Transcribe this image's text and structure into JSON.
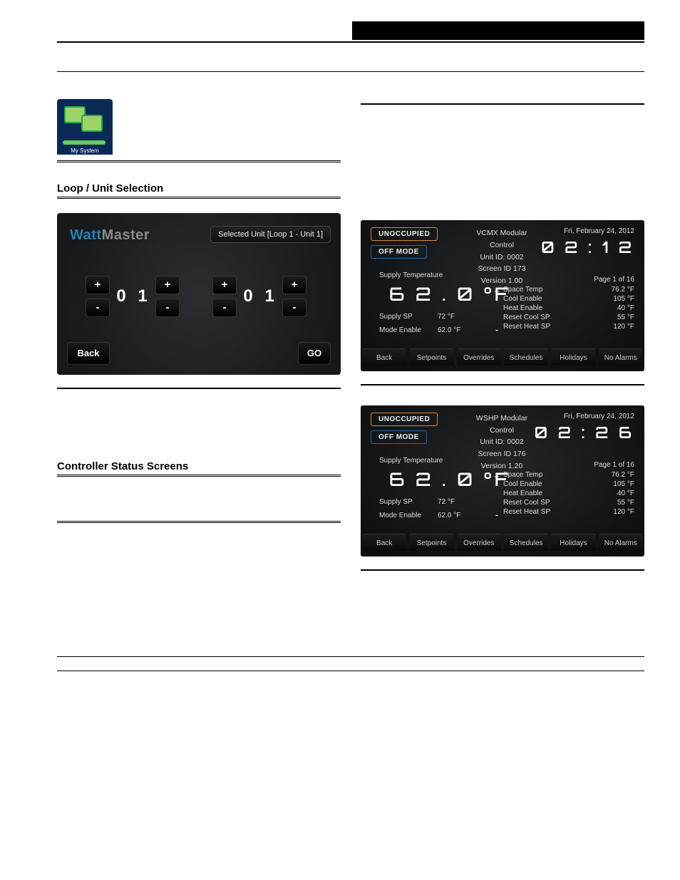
{
  "header": {
    "black_bar_label": ""
  },
  "left": {
    "mysystem_icon_label": "My System",
    "subhead1": "Loop / Unit Selection",
    "subhead2": "Controller Status Screens",
    "wm": {
      "logo_watt": "Watt",
      "logo_master": "Master",
      "chip": "Selected Unit [Loop 1 - Unit 1]",
      "stepper_plus": "+",
      "stepper_minus": "-",
      "digit_left_a": "0",
      "digit_left_b": "1",
      "digit_right_a": "0",
      "digit_right_b": "1",
      "back": "Back",
      "go": "GO"
    }
  },
  "right": {
    "ctl1": {
      "badge1": "UNOCCUPIED",
      "badge2": "OFF MODE",
      "mid_title": "VCMX Modular Control",
      "mid_unit": "Unit ID: 0002",
      "mid_screen": "Screen ID   173",
      "mid_ver": "Version  1.00",
      "date": "Fri, February 24, 2012",
      "clock": "0 2 : 1 2",
      "pageof": "Page 1 of 16",
      "supply_lbl": "Supply Temperature",
      "supply_big": "6 2 . 0 °F",
      "left_k1": "Supply SP",
      "left_v1": "72 °F",
      "left_k2": "Mode Enable",
      "left_v2": "62.0 °F",
      "plus": "+",
      "minus": "-",
      "r1k": "Space Temp",
      "r1v": "76.2 °F",
      "r2k": "Cool Enable",
      "r2v": "105 °F",
      "r3k": "Heat Enable",
      "r3v": "40 °F",
      "r4k": "Reset Cool SP",
      "r4v": "55 °F",
      "r5k": "Reset Heat SP",
      "r5v": "120 °F",
      "b1": "Back",
      "b2": "Setpoints",
      "b3": "Overrides",
      "b4": "Schedules",
      "b5": "Holidays",
      "b6": "No Alarms"
    },
    "ctl2": {
      "badge1": "UNOCCUPIED",
      "badge2": "OFF MODE",
      "mid_title": "WSHP Modular Control",
      "mid_unit": "Unit ID: 0002",
      "mid_screen": "Screen ID   176",
      "mid_ver": "Version  1.20",
      "date": "Fri, February 24, 2012",
      "clock": "0 2 : 2 6",
      "pageof": "Page 1 of 16",
      "supply_lbl": "Supply Temperature",
      "supply_big": "6 2 . 0 °F",
      "left_k1": "Supply SP",
      "left_v1": "72 °F",
      "left_k2": "Mode Enable",
      "left_v2": "62.0 °F",
      "plus": "+",
      "minus": "-",
      "r1k": "Space Temp",
      "r1v": "76.2 °F",
      "r2k": "Cool Enable",
      "r2v": "105 °F",
      "r3k": "Heat Enable",
      "r3v": "40 °F",
      "r4k": "Reset Cool SP",
      "r4v": "55 °F",
      "r5k": "Reset Heat SP",
      "r5v": "120 °F",
      "b1": "Back",
      "b2": "Setpoints",
      "b3": "Overrides",
      "b4": "Schedules",
      "b5": "Holidays",
      "b6": "No Alarms"
    }
  }
}
